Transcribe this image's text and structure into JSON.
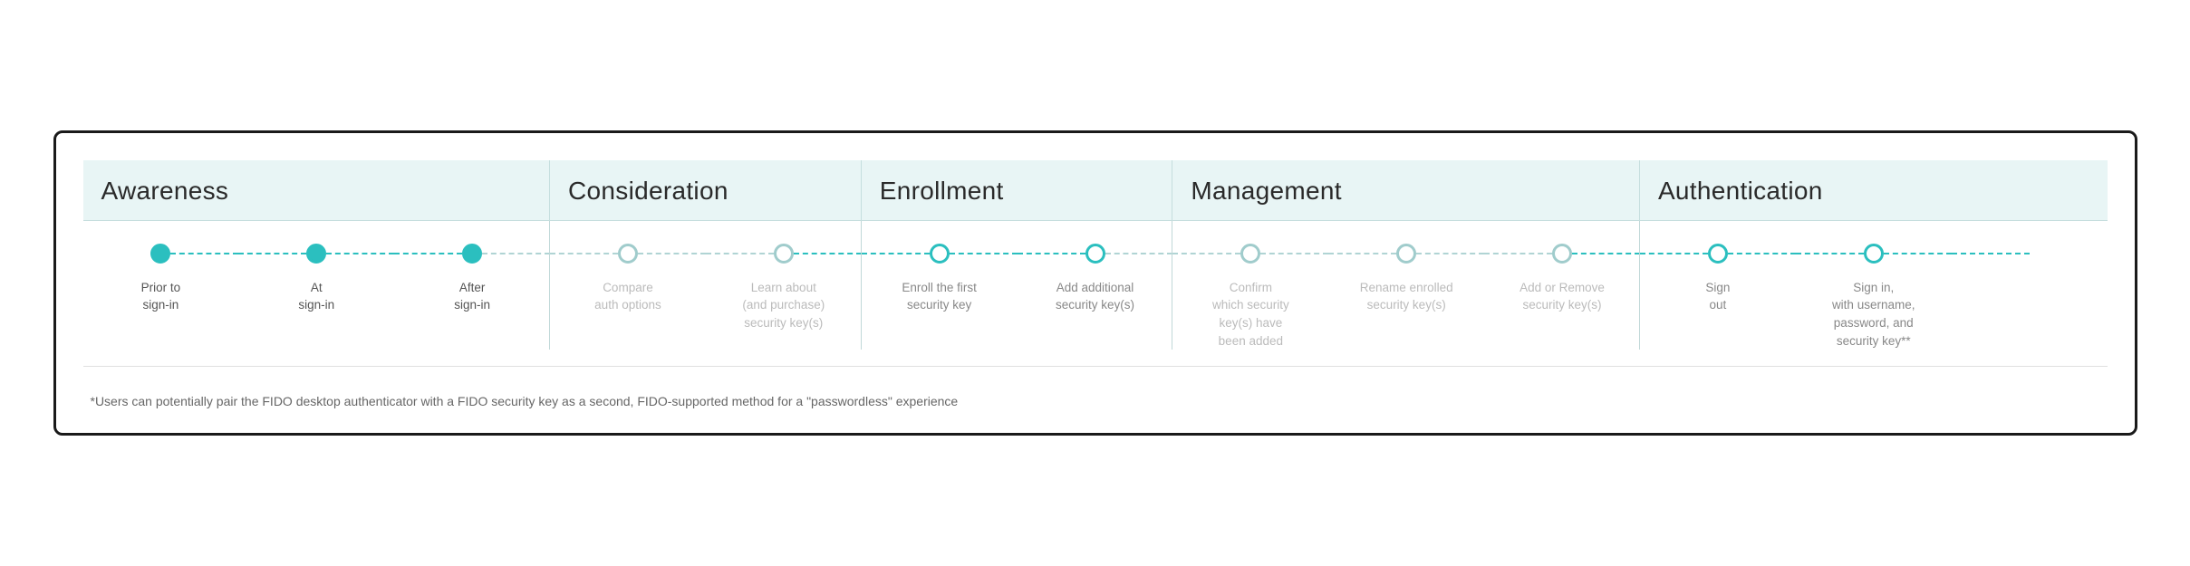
{
  "chart": {
    "phases": [
      {
        "id": "awareness",
        "label": "Awareness",
        "colSpan": 3
      },
      {
        "id": "consideration",
        "label": "Consideration",
        "colSpan": 2
      },
      {
        "id": "enrollment",
        "label": "Enrollment",
        "colSpan": 2
      },
      {
        "id": "management",
        "label": "Management",
        "colSpan": 3
      },
      {
        "id": "authentication",
        "label": "Authentication",
        "colSpan": 3
      }
    ],
    "steps": [
      {
        "id": "prior-to-sign-in",
        "label": "Prior to\nsign-in",
        "style": "filled",
        "dashLeft": "invisible",
        "dashRight": "teal"
      },
      {
        "id": "at-sign-in",
        "label": "At\nsign-in",
        "style": "filled",
        "dashLeft": "teal",
        "dashRight": "teal"
      },
      {
        "id": "after-sign-in",
        "label": "After\nsign-in",
        "style": "filled",
        "dashLeft": "teal",
        "dashRight": "teal",
        "phaseEnd": true
      },
      {
        "id": "compare-auth-options",
        "label": "Compare\nauth options",
        "style": "outline-faded",
        "dashLeft": "faded",
        "dashRight": "faded"
      },
      {
        "id": "learn-about-security-keys",
        "label": "Learn about\n(and purchase)\nsecurity key(s)",
        "style": "outline-faded",
        "dashLeft": "faded",
        "dashRight": "faded",
        "phaseEnd": true
      },
      {
        "id": "enroll-first-key",
        "label": "Enroll the first\nsecurity key",
        "style": "outline",
        "dashLeft": "teal",
        "dashRight": "teal"
      },
      {
        "id": "add-additional-keys",
        "label": "Add additional\nsecurity key(s)",
        "style": "outline",
        "dashLeft": "teal",
        "dashRight": "teal",
        "phaseEnd": true
      },
      {
        "id": "confirm-keys-added",
        "label": "Confirm\nwhich security\nkey(s) have\nbeen added",
        "style": "outline-faded",
        "dashLeft": "faded",
        "dashRight": "faded"
      },
      {
        "id": "rename-enrolled-keys",
        "label": "Rename enrolled\nsecurity key(s)",
        "style": "outline-faded",
        "dashLeft": "faded",
        "dashRight": "faded"
      },
      {
        "id": "add-or-remove-keys",
        "label": "Add or Remove\nsecurity key(s)",
        "style": "outline-faded",
        "dashLeft": "faded",
        "dashRight": "faded",
        "phaseEnd": true
      },
      {
        "id": "sign-out",
        "label": "Sign\nout",
        "style": "outline",
        "dashLeft": "teal",
        "dashRight": "teal"
      },
      {
        "id": "sign-in-with-credentials",
        "label": "Sign in,\nwith username,\npassword, and\nsecurity key**",
        "style": "outline",
        "dashLeft": "teal",
        "dashRight": "teal"
      },
      {
        "id": "last-dummy",
        "label": "",
        "style": "invisible",
        "dashLeft": "teal",
        "dashRight": "invisible"
      }
    ],
    "footer_note": "*Users can potentially pair the FIDO desktop authenticator with a FIDO security key as a second, FIDO-supported method for a \"passwordless\" experience"
  }
}
